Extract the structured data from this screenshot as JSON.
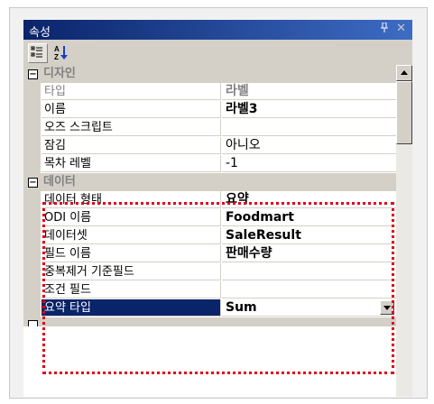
{
  "window": {
    "title": "속성",
    "pin_glyph": "ᵖ",
    "close_glyph": "✕"
  },
  "toolbar": {
    "categorized_tooltip": "categorized",
    "alphabetical_tooltip": "alphabetical"
  },
  "categories": [
    {
      "toggle": "−",
      "label": "디자인"
    },
    {
      "toggle": "−",
      "label": "데이터"
    }
  ],
  "design_rows": [
    {
      "name": "타입",
      "value": "라벨"
    },
    {
      "name": "이름",
      "value": "라벨3"
    },
    {
      "name": "오즈 스크립트",
      "value": ""
    },
    {
      "name": "잠김",
      "value": "아니오"
    },
    {
      "name": "목차 레벨",
      "value": "-1"
    }
  ],
  "data_rows": [
    {
      "name": "데이터 형태",
      "value": "요약"
    },
    {
      "name": "ODI 이름",
      "value": "Foodmart"
    },
    {
      "name": "데이터셋",
      "value": "SaleResult"
    },
    {
      "name": "필드 이름",
      "value": "판매수량"
    },
    {
      "name": "중복제거 기준필드",
      "value": ""
    },
    {
      "name": "조건 필드",
      "value": ""
    },
    {
      "name": "요약 타입",
      "value": "Sum"
    }
  ],
  "colors": {
    "title_bar": "#0a246a",
    "selection": "#0a246a",
    "highlight_border": "#e0001a",
    "panel_bg": "#d4d0c8"
  }
}
